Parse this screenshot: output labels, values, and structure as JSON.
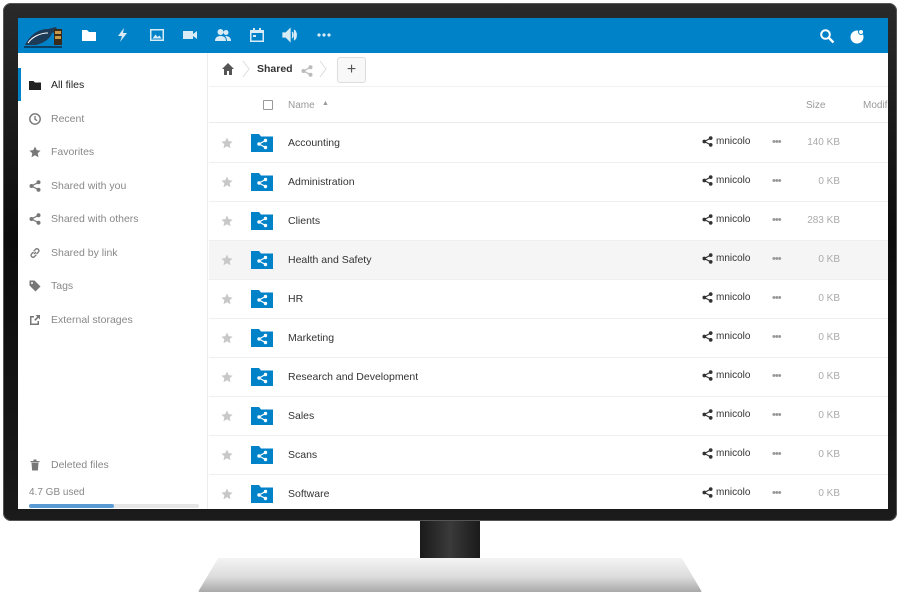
{
  "header": {
    "apps": [
      "files-icon",
      "activity-icon",
      "gallery-icon",
      "video-icon",
      "contacts-icon",
      "calendar-icon",
      "audio-icon",
      "more-apps-icon"
    ],
    "right": [
      "search-icon",
      "user-menu-icon"
    ],
    "color": "#0082c9"
  },
  "sidebar": {
    "items": [
      {
        "label": "All files",
        "icon": "folder-icon",
        "active": true
      },
      {
        "label": "Recent",
        "icon": "clock-icon"
      },
      {
        "label": "Favorites",
        "icon": "star-icon"
      },
      {
        "label": "Shared with you",
        "icon": "share-icon"
      },
      {
        "label": "Shared with others",
        "icon": "share-icon"
      },
      {
        "label": "Shared by link",
        "icon": "link-icon"
      },
      {
        "label": "Tags",
        "icon": "tag-icon"
      },
      {
        "label": "External storages",
        "icon": "external-icon"
      }
    ],
    "deleted_label": "Deleted files",
    "quota_label": "4.7 GB used",
    "quota_fraction": 0.5
  },
  "breadcrumb": {
    "current": "Shared",
    "add_label": "+"
  },
  "table": {
    "col_name": "Name",
    "col_size": "Size",
    "col_modified": "Modif",
    "rows": [
      {
        "name": "Accounting",
        "owner": "mnicolo",
        "size": "140 KB"
      },
      {
        "name": "Administration",
        "owner": "mnicolo",
        "size": "0 KB"
      },
      {
        "name": "Clients",
        "owner": "mnicolo",
        "size": "283 KB"
      },
      {
        "name": "Health and Safety",
        "owner": "mnicolo",
        "size": "0 KB"
      },
      {
        "name": "HR",
        "owner": "mnicolo",
        "size": "0 KB"
      },
      {
        "name": "Marketing",
        "owner": "mnicolo",
        "size": "0 KB"
      },
      {
        "name": "Research and Development",
        "owner": "mnicolo",
        "size": "0 KB"
      },
      {
        "name": "Sales",
        "owner": "mnicolo",
        "size": "0 KB"
      },
      {
        "name": "Scans",
        "owner": "mnicolo",
        "size": "0 KB"
      },
      {
        "name": "Software",
        "owner": "mnicolo",
        "size": "0 KB"
      }
    ]
  }
}
